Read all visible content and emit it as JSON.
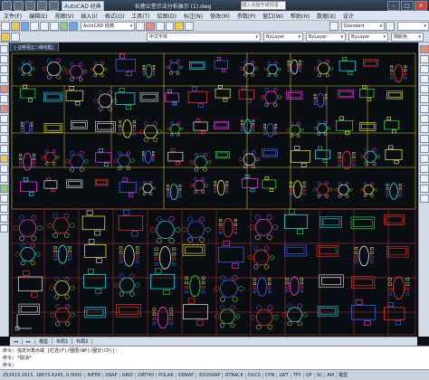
{
  "titlebar": {
    "workspace": "AutoCAD 经典",
    "title": "长鹿公堂示法分析展示 (1).dwg",
    "search_placeholder": "键入关键字或短语"
  },
  "menubar": {
    "items": [
      "文件(F)",
      "编辑(E)",
      "视图(V)",
      "插入(I)",
      "格式(O)",
      "工具(T)",
      "绘图(D)",
      "标注(N)",
      "修改(M)",
      "参数(P)",
      "窗口(W)",
      "帮助(H)",
      "数据(X)",
      "设计"
    ]
  },
  "toolbar1": {
    "workspace_combo": "AutoCAD 经典",
    "text_style": "Standard"
  },
  "toolbar2": {
    "layer_combo": "中文字体",
    "color_combo": "ByLayer",
    "linetype_combo": "ByLayer",
    "lineweight_combo": "ByLayer",
    "plot_combo": "随颜色"
  },
  "document_tab": "[-][俯视][二维线框]",
  "layout_tabs": [
    "模型",
    "布局1",
    "布局2"
  ],
  "command_line": {
    "line1": "命令: 指定对角点或 [栏选(F)/圈围(WP)/圈交(CP)]:",
    "line2": "命令: *取消*",
    "prompt": "命令:"
  },
  "status_bar": {
    "coords": "252413.1615, 18673.6245, 0.0000",
    "buttons": [
      "INFER",
      "SNAP",
      "GRID",
      "ORTHO",
      "POLAR",
      "OSNAP",
      "3DOSNAP",
      "OTRACK",
      "DUCS",
      "DYN",
      "LWT",
      "TPY",
      "QP",
      "SC",
      "AM"
    ],
    "model": "模型"
  },
  "colors": {
    "canvas_bg": "#0a0d12",
    "grid_yellow": "#d8c83a",
    "grid_red": "#c23a3a",
    "magenta": "#ff3df2",
    "cyan": "#30e6ff",
    "green": "#35e04a",
    "yellow": "#f7f23a",
    "white": "#e8e8e8",
    "red": "#ff3b2f",
    "blue": "#4a6cff"
  },
  "icons": [
    "new-icon",
    "open-icon",
    "save-icon",
    "print-icon",
    "undo-icon",
    "redo-icon",
    "pan-icon",
    "zoom-icon",
    "line-icon",
    "polyline-icon",
    "circle-icon",
    "arc-icon",
    "rectangle-icon",
    "hatch-icon",
    "text-icon",
    "move-icon",
    "copy-icon",
    "rotate-icon",
    "trim-icon",
    "erase-icon",
    "layer-icon"
  ]
}
